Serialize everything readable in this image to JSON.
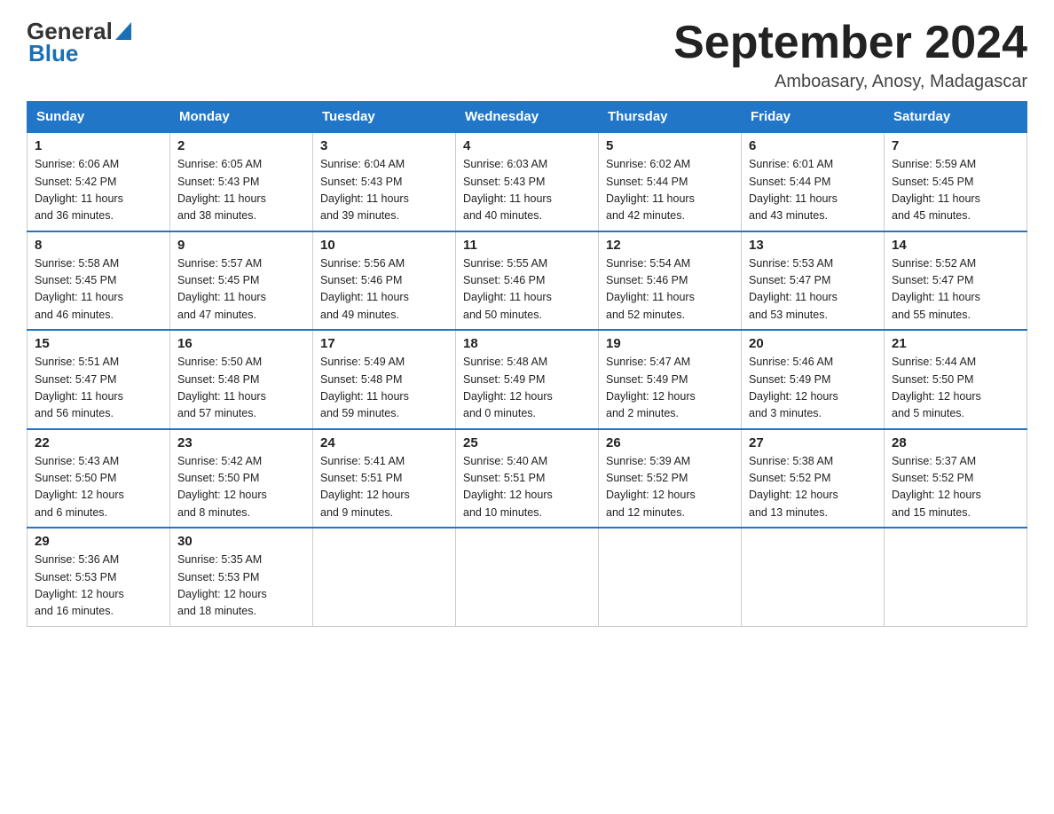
{
  "logo": {
    "text_general": "General",
    "text_blue": "Blue",
    "triangle": "▶"
  },
  "title": {
    "month_year": "September 2024",
    "location": "Amboasary, Anosy, Madagascar"
  },
  "header_days": [
    "Sunday",
    "Monday",
    "Tuesday",
    "Wednesday",
    "Thursday",
    "Friday",
    "Saturday"
  ],
  "weeks": [
    [
      {
        "day": "1",
        "sunrise": "6:06 AM",
        "sunset": "5:42 PM",
        "daylight": "11 hours and 36 minutes."
      },
      {
        "day": "2",
        "sunrise": "6:05 AM",
        "sunset": "5:43 PM",
        "daylight": "11 hours and 38 minutes."
      },
      {
        "day": "3",
        "sunrise": "6:04 AM",
        "sunset": "5:43 PM",
        "daylight": "11 hours and 39 minutes."
      },
      {
        "day": "4",
        "sunrise": "6:03 AM",
        "sunset": "5:43 PM",
        "daylight": "11 hours and 40 minutes."
      },
      {
        "day": "5",
        "sunrise": "6:02 AM",
        "sunset": "5:44 PM",
        "daylight": "11 hours and 42 minutes."
      },
      {
        "day": "6",
        "sunrise": "6:01 AM",
        "sunset": "5:44 PM",
        "daylight": "11 hours and 43 minutes."
      },
      {
        "day": "7",
        "sunrise": "5:59 AM",
        "sunset": "5:45 PM",
        "daylight": "11 hours and 45 minutes."
      }
    ],
    [
      {
        "day": "8",
        "sunrise": "5:58 AM",
        "sunset": "5:45 PM",
        "daylight": "11 hours and 46 minutes."
      },
      {
        "day": "9",
        "sunrise": "5:57 AM",
        "sunset": "5:45 PM",
        "daylight": "11 hours and 47 minutes."
      },
      {
        "day": "10",
        "sunrise": "5:56 AM",
        "sunset": "5:46 PM",
        "daylight": "11 hours and 49 minutes."
      },
      {
        "day": "11",
        "sunrise": "5:55 AM",
        "sunset": "5:46 PM",
        "daylight": "11 hours and 50 minutes."
      },
      {
        "day": "12",
        "sunrise": "5:54 AM",
        "sunset": "5:46 PM",
        "daylight": "11 hours and 52 minutes."
      },
      {
        "day": "13",
        "sunrise": "5:53 AM",
        "sunset": "5:47 PM",
        "daylight": "11 hours and 53 minutes."
      },
      {
        "day": "14",
        "sunrise": "5:52 AM",
        "sunset": "5:47 PM",
        "daylight": "11 hours and 55 minutes."
      }
    ],
    [
      {
        "day": "15",
        "sunrise": "5:51 AM",
        "sunset": "5:47 PM",
        "daylight": "11 hours and 56 minutes."
      },
      {
        "day": "16",
        "sunrise": "5:50 AM",
        "sunset": "5:48 PM",
        "daylight": "11 hours and 57 minutes."
      },
      {
        "day": "17",
        "sunrise": "5:49 AM",
        "sunset": "5:48 PM",
        "daylight": "11 hours and 59 minutes."
      },
      {
        "day": "18",
        "sunrise": "5:48 AM",
        "sunset": "5:49 PM",
        "daylight": "12 hours and 0 minutes."
      },
      {
        "day": "19",
        "sunrise": "5:47 AM",
        "sunset": "5:49 PM",
        "daylight": "12 hours and 2 minutes."
      },
      {
        "day": "20",
        "sunrise": "5:46 AM",
        "sunset": "5:49 PM",
        "daylight": "12 hours and 3 minutes."
      },
      {
        "day": "21",
        "sunrise": "5:44 AM",
        "sunset": "5:50 PM",
        "daylight": "12 hours and 5 minutes."
      }
    ],
    [
      {
        "day": "22",
        "sunrise": "5:43 AM",
        "sunset": "5:50 PM",
        "daylight": "12 hours and 6 minutes."
      },
      {
        "day": "23",
        "sunrise": "5:42 AM",
        "sunset": "5:50 PM",
        "daylight": "12 hours and 8 minutes."
      },
      {
        "day": "24",
        "sunrise": "5:41 AM",
        "sunset": "5:51 PM",
        "daylight": "12 hours and 9 minutes."
      },
      {
        "day": "25",
        "sunrise": "5:40 AM",
        "sunset": "5:51 PM",
        "daylight": "12 hours and 10 minutes."
      },
      {
        "day": "26",
        "sunrise": "5:39 AM",
        "sunset": "5:52 PM",
        "daylight": "12 hours and 12 minutes."
      },
      {
        "day": "27",
        "sunrise": "5:38 AM",
        "sunset": "5:52 PM",
        "daylight": "12 hours and 13 minutes."
      },
      {
        "day": "28",
        "sunrise": "5:37 AM",
        "sunset": "5:52 PM",
        "daylight": "12 hours and 15 minutes."
      }
    ],
    [
      {
        "day": "29",
        "sunrise": "5:36 AM",
        "sunset": "5:53 PM",
        "daylight": "12 hours and 16 minutes."
      },
      {
        "day": "30",
        "sunrise": "5:35 AM",
        "sunset": "5:53 PM",
        "daylight": "12 hours and 18 minutes."
      },
      null,
      null,
      null,
      null,
      null
    ]
  ],
  "labels": {
    "sunrise": "Sunrise:",
    "sunset": "Sunset:",
    "daylight": "Daylight:"
  }
}
